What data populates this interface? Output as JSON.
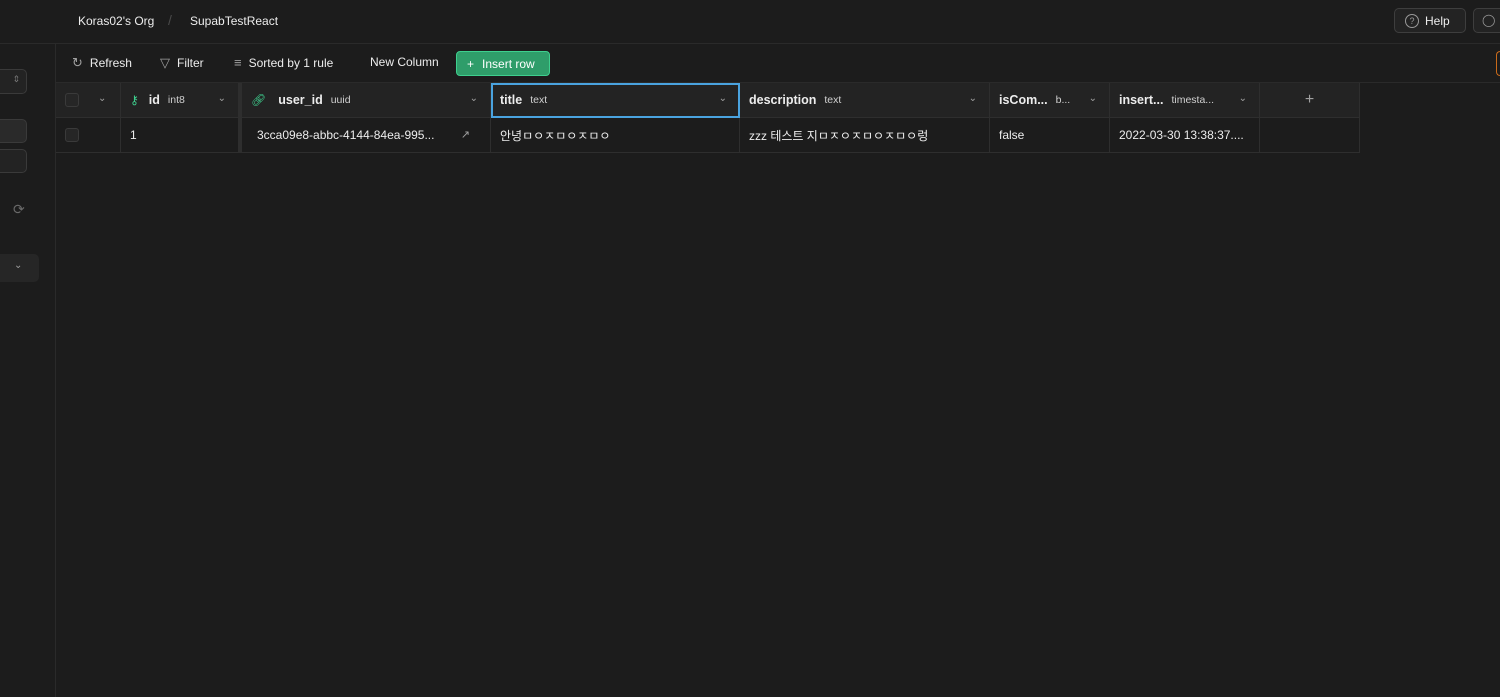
{
  "header": {
    "org": "Koras02's Org",
    "separator": "/",
    "project": "SupabTestReact",
    "help_label": "Help",
    "help_icon": "?",
    "feedback_icon": "◯"
  },
  "toolbar": {
    "refresh_label": "Refresh",
    "filter_label": "Filter",
    "sort_label": "Sorted by 1 rule",
    "new_column_label": "New Column",
    "insert_row_label": "Insert row"
  },
  "table": {
    "columns": [
      {
        "name": "id",
        "type": "int8"
      },
      {
        "name": "user_id",
        "type": "uuid"
      },
      {
        "name": "title",
        "type": "text"
      },
      {
        "name": "description",
        "type": "text"
      },
      {
        "name": "isCom...",
        "type": "b..."
      },
      {
        "name": "insert...",
        "type": "timesta..."
      }
    ],
    "add_column_symbol": "+",
    "rows": [
      {
        "id": "1",
        "user_id": "3cca09e8-abbc-4144-84ea-995...",
        "title": "안녕ㅁㅇㅈㅁㅇㅈㅁㅇ",
        "description": "zzz 테스트 지ㅁㅈㅇㅈㅁㅇㅈㅁㅇ렁",
        "isCompleted": "false",
        "inserted_at": "2022-03-30 13:38:37...."
      }
    ]
  },
  "colors": {
    "accent": "#3ecf8e",
    "selection": "#4aa3df",
    "background": "#1c1c1c"
  }
}
